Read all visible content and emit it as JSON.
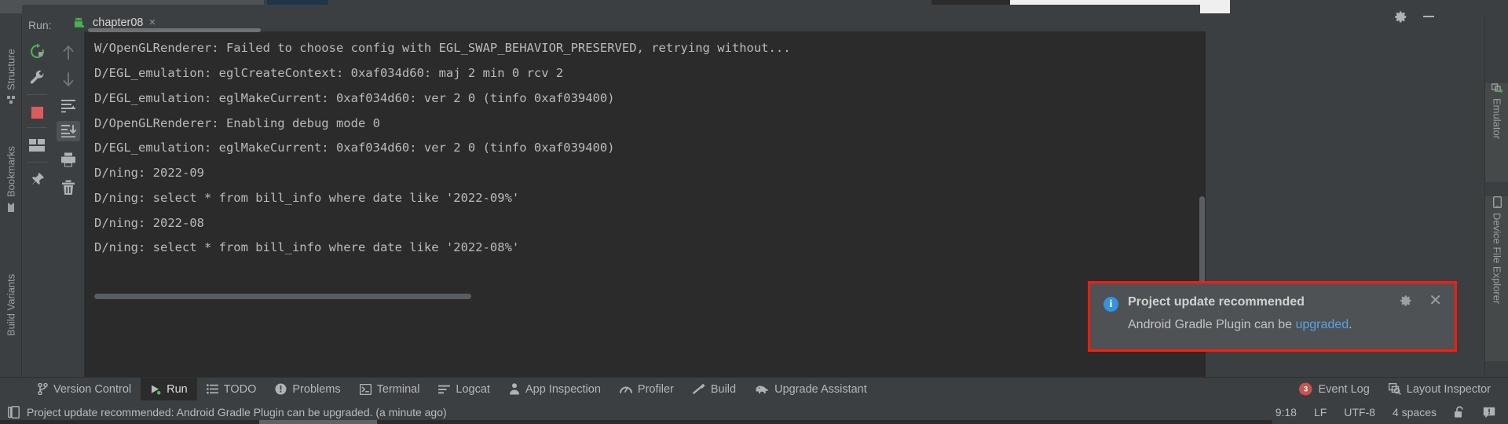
{
  "window": {
    "accent_blue": "#4a88c7",
    "console_bg": "#2b2b2b",
    "panel_bg": "#3c3f41",
    "alert_red": "#ff1a0d"
  },
  "run_panel": {
    "run_label": "Run:",
    "tab_title": "chapter08",
    "tab_close": "×",
    "gear_icon": "gear-icon",
    "minimize_icon": "minimize-icon",
    "toolbar_left": [
      {
        "name": "rerun-icon",
        "title": "Rerun"
      },
      {
        "name": "wrench-icon",
        "title": "Edit Configuration"
      },
      {
        "name": "stop-icon",
        "title": "Stop"
      },
      {
        "name": "layout-icon",
        "title": "Layout"
      },
      {
        "name": "pin-icon",
        "title": "Pin Tab"
      }
    ],
    "toolbar_right": [
      {
        "name": "arrow-up-icon",
        "title": "Up the Stack Trace"
      },
      {
        "name": "arrow-down-icon",
        "title": "Down the Stack Trace"
      },
      {
        "name": "soft-wrap-icon",
        "title": "Use Soft Wraps"
      },
      {
        "name": "scroll-to-end-icon",
        "title": "Scroll to End"
      },
      {
        "name": "print-icon",
        "title": "Print"
      },
      {
        "name": "trash-icon",
        "title": "Clear All"
      }
    ]
  },
  "console": {
    "lines": [
      "W/OpenGLRenderer: Failed to choose config with EGL_SWAP_BEHAVIOR_PRESERVED, retrying without...",
      "D/EGL_emulation: eglCreateContext: 0xaf034d60: maj 2 min 0 rcv 2",
      "D/EGL_emulation: eglMakeCurrent: 0xaf034d60: ver 2 0 (tinfo 0xaf039400)",
      "D/OpenGLRenderer: Enabling debug mode 0",
      "D/EGL_emulation: eglMakeCurrent: 0xaf034d60: ver 2 0 (tinfo 0xaf039400)",
      "D/ning: 2022-09",
      "D/ning: select * from bill_info where date like '2022-09%'",
      "D/ning: 2022-08",
      "D/ning: select * from bill_info where date like '2022-08%'"
    ]
  },
  "left_tool_strip": [
    {
      "label": "Structure",
      "icon": "structure-icon"
    },
    {
      "label": "Bookmarks",
      "icon": "bookmark-icon"
    },
    {
      "label": "Build Variants",
      "icon": ""
    }
  ],
  "right_tool_strip": [
    {
      "label": "Emulator",
      "icon": "emulator-icon"
    },
    {
      "label": "Device File Explorer",
      "icon": "device-icon"
    }
  ],
  "balloon": {
    "info_glyph": "i",
    "title": "Project update recommended",
    "body_prefix": "Android Gradle Plugin can be ",
    "body_link": "upgraded",
    "body_suffix": ".",
    "gear_icon": "gear-icon",
    "close_icon": "close-icon"
  },
  "bottom_tabs": [
    {
      "label": "Version Control",
      "icon": "branch-icon",
      "active": false
    },
    {
      "label": "Run",
      "icon": "run-icon",
      "active": true
    },
    {
      "label": "TODO",
      "icon": "list-icon",
      "active": false
    },
    {
      "label": "Problems",
      "icon": "warning-icon",
      "active": false
    },
    {
      "label": "Terminal",
      "icon": "terminal-icon",
      "active": false
    },
    {
      "label": "Logcat",
      "icon": "logcat-icon",
      "active": false
    },
    {
      "label": "App Inspection",
      "icon": "inspection-icon",
      "active": false
    },
    {
      "label": "Profiler",
      "icon": "profiler-icon",
      "active": false
    },
    {
      "label": "Build",
      "icon": "hammer-icon",
      "active": false
    },
    {
      "label": "Upgrade Assistant",
      "icon": "elephant-icon",
      "active": false
    }
  ],
  "bottom_tabs_right": [
    {
      "label": "Event Log",
      "icon": "badge-icon",
      "badge": "3",
      "active": false
    },
    {
      "label": "Layout Inspector",
      "icon": "layout-inspector-icon",
      "active": false
    }
  ],
  "status_bar": {
    "message_icon": "message-icon",
    "message": "Project update recommended: Android Gradle Plugin can be upgraded. (a minute ago)",
    "caret_position": "9:18",
    "line_separator": "LF",
    "encoding": "UTF-8",
    "indent": "4 spaces",
    "lock_icon": "unlock-icon",
    "notify_icon": "notification-icon"
  }
}
